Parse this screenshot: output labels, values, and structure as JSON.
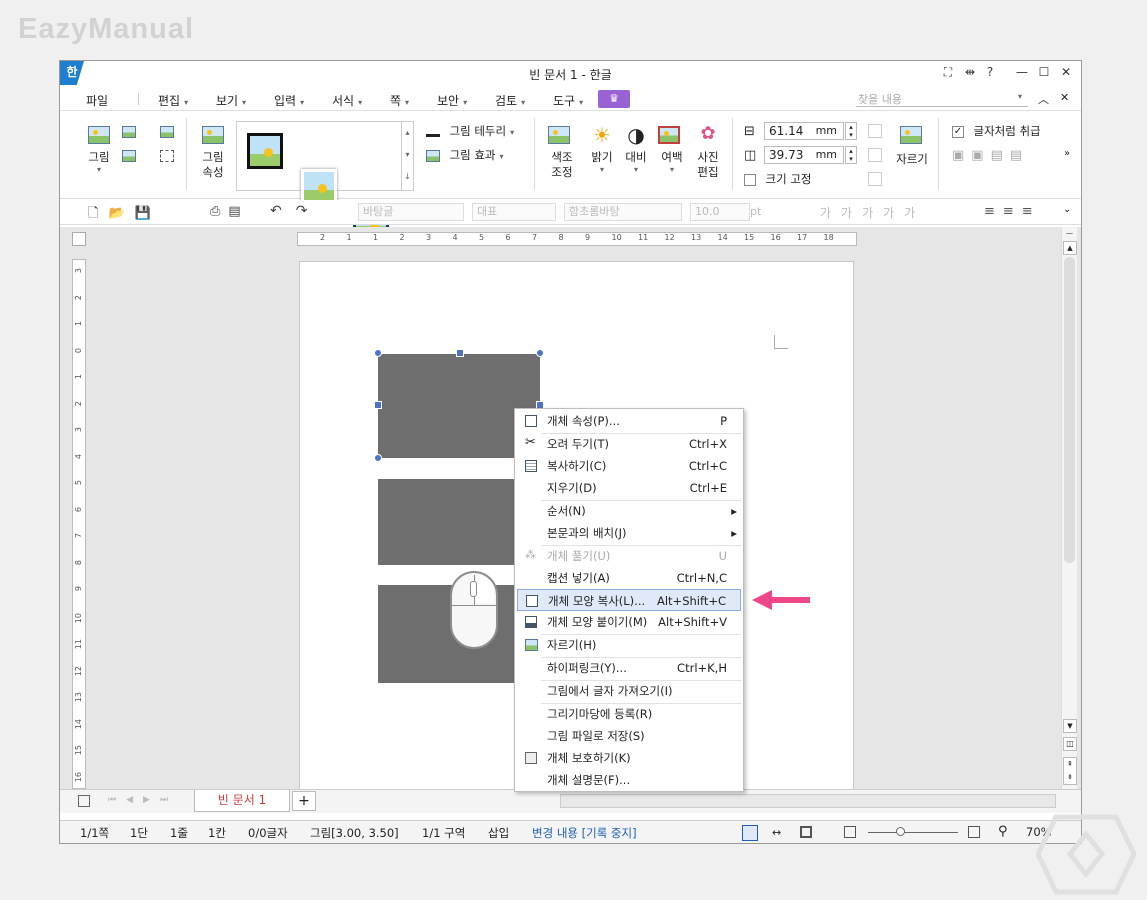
{
  "watermark": "EazyManual",
  "window": {
    "title": "빈 문서 1 - 한글",
    "logo": "한"
  },
  "menubar": {
    "items": [
      {
        "label": "파일"
      },
      {
        "label": "편집"
      },
      {
        "label": "보기"
      },
      {
        "label": "입력"
      },
      {
        "label": "서식"
      },
      {
        "label": "쪽"
      },
      {
        "label": "보안"
      },
      {
        "label": "검토"
      },
      {
        "label": "도구"
      }
    ],
    "find_placeholder": "찾을 내용"
  },
  "ribbon": {
    "picture": "그림",
    "picture_props_1": "그림",
    "picture_props_2": "속성",
    "border": "그림 테두리",
    "effect": "그림 효과",
    "color_1": "색조",
    "color_2": "조정",
    "brightness": "밝기",
    "contrast": "대비",
    "margin": "여백",
    "photo_1": "사진",
    "photo_2": "편집",
    "width": "61.14",
    "height": "39.73",
    "unit": "mm",
    "fix_size": "크기 고정",
    "crop": "자르기",
    "treat_as_char": "글자처럼 취급"
  },
  "toolbar2": {
    "style": "바탕글",
    "lang": "대표",
    "font": "함초롬바탕",
    "size": "10.0",
    "size_unit": "pt"
  },
  "ruler": {
    "h_ticks": [
      "2",
      "1",
      "1",
      "2",
      "3",
      "4",
      "5",
      "6",
      "7",
      "8",
      "9",
      "10",
      "11",
      "12",
      "13",
      "14",
      "15",
      "16",
      "17",
      "18"
    ],
    "v_ticks": [
      "3",
      "2",
      "1",
      "0",
      "1",
      "2",
      "3",
      "4",
      "5",
      "6",
      "7",
      "8",
      "9",
      "10",
      "11",
      "12",
      "13",
      "14",
      "15",
      "16"
    ]
  },
  "context_menu": {
    "items": [
      {
        "label": "개체 속성(P)...",
        "shortcut": "P"
      },
      {
        "label": "오려 두기(T)",
        "shortcut": "Ctrl+X"
      },
      {
        "label": "복사하기(C)",
        "shortcut": "Ctrl+C"
      },
      {
        "label": "지우기(D)",
        "shortcut": "Ctrl+E"
      },
      {
        "label": "순서(N)",
        "shortcut": "▸"
      },
      {
        "label": "본문과의 배치(J)",
        "shortcut": "▸"
      },
      {
        "label": "개체 풀기(U)",
        "shortcut": "U"
      },
      {
        "label": "캡션 넣기(A)",
        "shortcut": "Ctrl+N,C"
      },
      {
        "label": "개체 모양 복사(L)...",
        "shortcut": "Alt+Shift+C"
      },
      {
        "label": "개체 모양 붙이기(M)",
        "shortcut": "Alt+Shift+V"
      },
      {
        "label": "자르기(H)",
        "shortcut": ""
      },
      {
        "label": "하이퍼링크(Y)...",
        "shortcut": "Ctrl+K,H"
      },
      {
        "label": "그림에서 글자 가져오기(I)",
        "shortcut": ""
      },
      {
        "label": "그리기마당에 등록(R)",
        "shortcut": ""
      },
      {
        "label": "그림 파일로 저장(S)",
        "shortcut": ""
      },
      {
        "label": "개체 보호하기(K)",
        "shortcut": ""
      },
      {
        "label": "개체 설명문(F)...",
        "shortcut": ""
      }
    ]
  },
  "tabs": {
    "doc_tab": "빈 문서 1",
    "add": "+"
  },
  "statusbar": {
    "page": "1/1쪽",
    "column": "1단",
    "line": "1줄",
    "col": "1칸",
    "chars": "0/0글자",
    "object": "그림[3.00, 3.50]",
    "section": "1/1 구역",
    "insert": "삽입",
    "track": "변경 내용 [기록 중지]",
    "zoom": "70%"
  },
  "colors": {
    "accent": "#1e7fd0",
    "highlight_arrow": "#f0478a",
    "selection": "#4a74c9",
    "shape_fill": "#6e6e6e"
  }
}
